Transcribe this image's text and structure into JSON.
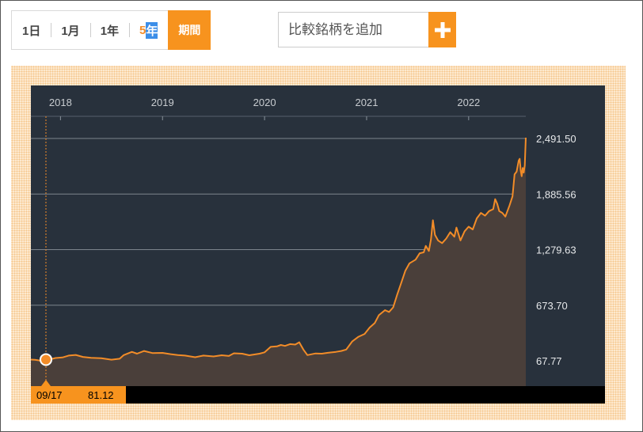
{
  "period_bar": {
    "buttons": [
      {
        "label": "1日",
        "active": false
      },
      {
        "label": "1月",
        "active": false
      },
      {
        "label": "1年",
        "active": false
      }
    ],
    "active_num": "5",
    "active_unit": "年",
    "custom_label": "期間"
  },
  "compare": {
    "placeholder": "比較銘柄を追加",
    "add_icon": "plus-icon"
  },
  "colors": {
    "accent": "#f7931e",
    "chart_bg": "#28313c",
    "line": "#f28c28",
    "area": "#4a3f3a",
    "highlight": "#3c8ee8"
  },
  "chart_data": {
    "type": "area",
    "x_tick_labels": [
      "2018",
      "2019",
      "2020",
      "2021",
      "2022"
    ],
    "y_tick_labels": [
      "2,491.50",
      "1,885.56",
      "1,279.63",
      "673.70",
      "67.77"
    ],
    "y_ticks": [
      2491.5,
      1885.56,
      1279.63,
      673.7,
      67.77
    ],
    "ylim": [
      67.77,
      2491.5
    ],
    "x_year_positions": [
      2018.0,
      2019.0,
      2020.0,
      2021.0,
      2022.0
    ],
    "xlim": [
      2017.71,
      2022.56
    ],
    "grid": true,
    "series": [
      {
        "points": [
          [
            2017.71,
            81
          ],
          [
            2017.75,
            79
          ],
          [
            2017.8,
            70
          ],
          [
            2017.88,
            77
          ],
          [
            2017.95,
            98
          ],
          [
            2018.02,
            104
          ],
          [
            2018.08,
            125
          ],
          [
            2018.15,
            132
          ],
          [
            2018.22,
            110
          ],
          [
            2018.3,
            100
          ],
          [
            2018.4,
            95
          ],
          [
            2018.5,
            80
          ],
          [
            2018.58,
            90
          ],
          [
            2018.62,
            130
          ],
          [
            2018.7,
            165
          ],
          [
            2018.75,
            145
          ],
          [
            2018.82,
            175
          ],
          [
            2018.9,
            152
          ],
          [
            2019.0,
            154
          ],
          [
            2019.08,
            140
          ],
          [
            2019.15,
            130
          ],
          [
            2019.22,
            125
          ],
          [
            2019.32,
            107
          ],
          [
            2019.4,
            125
          ],
          [
            2019.5,
            115
          ],
          [
            2019.58,
            128
          ],
          [
            2019.65,
            120
          ],
          [
            2019.7,
            150
          ],
          [
            2019.78,
            145
          ],
          [
            2019.85,
            128
          ],
          [
            2019.95,
            145
          ],
          [
            2020.0,
            160
          ],
          [
            2020.06,
            220
          ],
          [
            2020.12,
            225
          ],
          [
            2020.16,
            240
          ],
          [
            2020.2,
            230
          ],
          [
            2020.25,
            250
          ],
          [
            2020.3,
            245
          ],
          [
            2020.34,
            270
          ],
          [
            2020.38,
            190
          ],
          [
            2020.42,
            130
          ],
          [
            2020.5,
            148
          ],
          [
            2020.56,
            145
          ],
          [
            2020.62,
            155
          ],
          [
            2020.7,
            165
          ],
          [
            2020.75,
            175
          ],
          [
            2020.8,
            190
          ],
          [
            2020.86,
            280
          ],
          [
            2020.92,
            330
          ],
          [
            2020.98,
            360
          ],
          [
            2021.03,
            430
          ],
          [
            2021.08,
            480
          ],
          [
            2021.12,
            565
          ],
          [
            2021.18,
            620
          ],
          [
            2021.22,
            600
          ],
          [
            2021.26,
            650
          ],
          [
            2021.3,
            790
          ],
          [
            2021.34,
            920
          ],
          [
            2021.38,
            1050
          ],
          [
            2021.42,
            1130
          ],
          [
            2021.48,
            1170
          ],
          [
            2021.52,
            1240
          ],
          [
            2021.56,
            1250
          ],
          [
            2021.58,
            1320
          ],
          [
            2021.61,
            1265
          ],
          [
            2021.63,
            1390
          ],
          [
            2021.65,
            1600
          ],
          [
            2021.67,
            1440
          ],
          [
            2021.7,
            1380
          ],
          [
            2021.74,
            1350
          ],
          [
            2021.78,
            1400
          ],
          [
            2021.82,
            1470
          ],
          [
            2021.86,
            1420
          ],
          [
            2021.88,
            1520
          ],
          [
            2021.92,
            1380
          ],
          [
            2021.96,
            1480
          ],
          [
            2022.0,
            1530
          ],
          [
            2022.04,
            1500
          ],
          [
            2022.08,
            1620
          ],
          [
            2022.12,
            1680
          ],
          [
            2022.16,
            1650
          ],
          [
            2022.2,
            1700
          ],
          [
            2022.24,
            1720
          ],
          [
            2022.26,
            1830
          ],
          [
            2022.28,
            1780
          ],
          [
            2022.3,
            1700
          ],
          [
            2022.33,
            1680
          ],
          [
            2022.36,
            1640
          ],
          [
            2022.4,
            1760
          ],
          [
            2022.43,
            1860
          ],
          [
            2022.45,
            2100
          ],
          [
            2022.47,
            2130
          ],
          [
            2022.49,
            2250
          ],
          [
            2022.5,
            2270
          ],
          [
            2022.51,
            2140
          ],
          [
            2022.52,
            2080
          ],
          [
            2022.53,
            2170
          ],
          [
            2022.54,
            2120
          ],
          [
            2022.55,
            2200
          ],
          [
            2022.56,
            2500
          ]
        ]
      }
    ],
    "crosshair": {
      "date": "09/17",
      "value": "81.12",
      "x": 2017.71,
      "y": 81.12
    }
  }
}
